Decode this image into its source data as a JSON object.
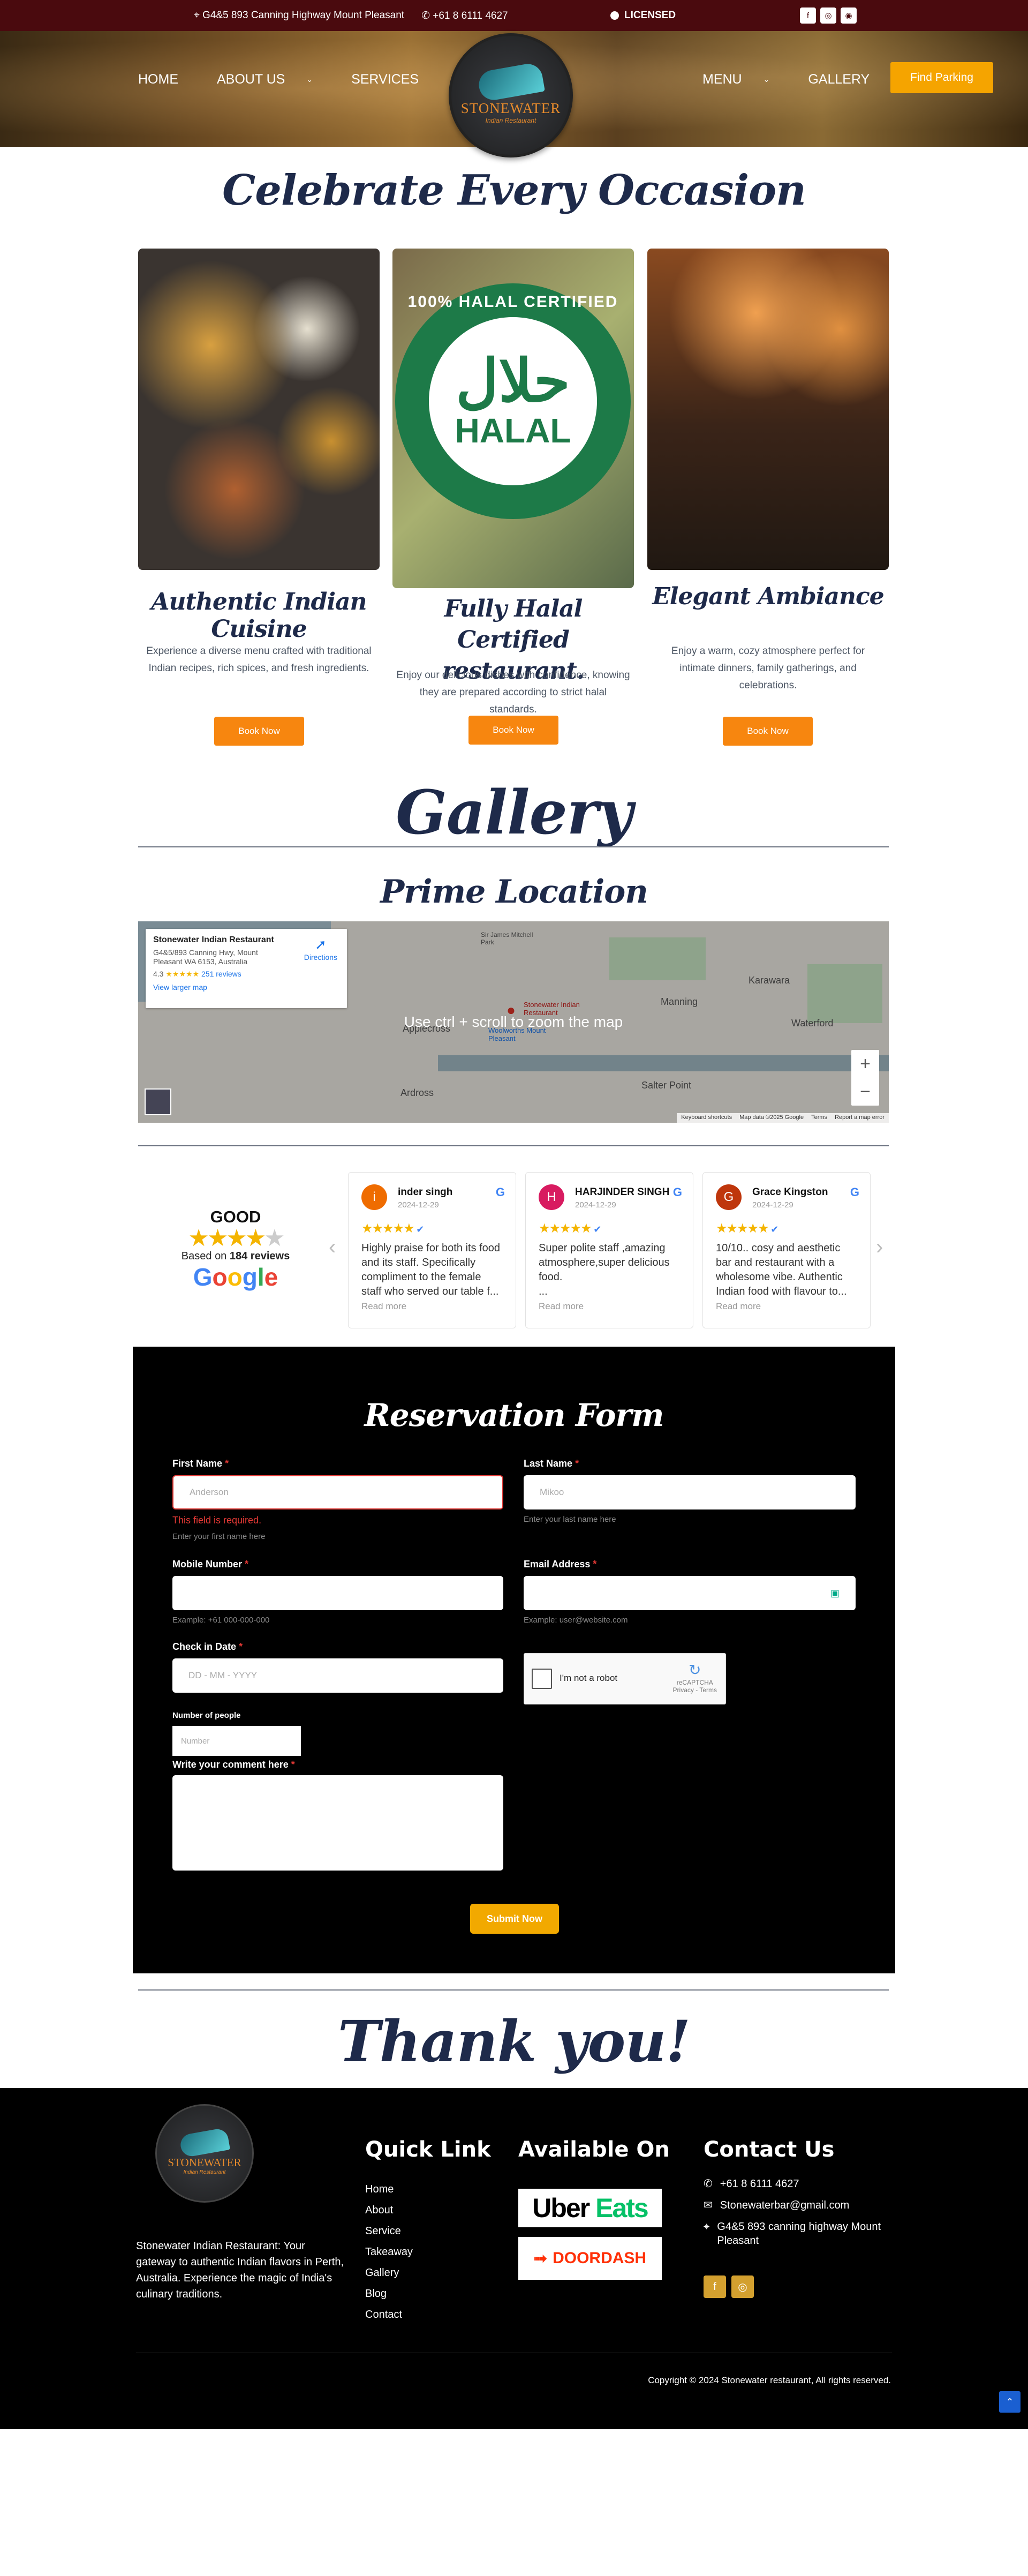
{
  "topbar": {
    "address": "G4&5 893 Canning Highway Mount Pleasant",
    "phone": "+61 8 6111 4627",
    "licensed": "LICENSED"
  },
  "nav": {
    "home": "HOME",
    "about": "ABOUT US",
    "services": "SERVICES",
    "menu": "MENU",
    "gallery": "GALLERY",
    "find_parking": "Find Parking"
  },
  "logo": {
    "name": "STONEWATER",
    "sub": "Indian Restaurant"
  },
  "celebrate": {
    "title": "Celebrate Every Occasion",
    "cards": [
      {
        "title": "Authentic Indian Cuisine",
        "desc": "Experience a diverse menu crafted with traditional Indian recipes, rich spices, and fresh ingredients.",
        "button": "Book Now"
      },
      {
        "title": "Fully Halal Certified restaurant.",
        "desc": "Enjoy our delicious dishes with confidence, knowing they are prepared according to strict halal standards.",
        "button": "Book Now"
      },
      {
        "title": "Elegant Ambiance",
        "desc": "Enjoy a warm, cozy atmosphere perfect for intimate dinners, family gatherings, and celebrations.",
        "button": "Book Now"
      }
    ],
    "halal": {
      "arabic": "حلال",
      "english": "HALAL",
      "ring": "100% HALAL CERTIFIED"
    }
  },
  "gallery_title": "Gallery",
  "location": {
    "title": "Prime Location",
    "info_name": "Stonewater Indian Restaurant",
    "info_address": "G4&5/893 Canning Hwy, Mount Pleasant WA 6153, Australia",
    "rating": "4.3",
    "reviews_link": "251 reviews",
    "directions": "Directions",
    "larger_map": "View larger map",
    "overlay": "Use ctrl + scroll to zoom the map",
    "places": [
      "Applecross",
      "Manning",
      "Karawara",
      "Waterford",
      "Salter Point",
      "Ardross",
      "Stonewater Indian Restaurant",
      "Woolworths Mount Pleasant",
      "Sir James Mitchell Park"
    ],
    "footer": [
      "Keyboard shortcuts",
      "Map data ©2025 Google",
      "Terms",
      "Report a map error"
    ]
  },
  "reviews": {
    "summary": {
      "label": "GOOD",
      "based": "Based on",
      "count": "184 reviews",
      "brand": "Google"
    },
    "items": [
      {
        "initial": "i",
        "name": "inder singh",
        "date": "2024-12-29",
        "text": "Highly praise for both its food and its staff. Specifically compliment to the female staff who served our table f...",
        "more": "Read more",
        "color": "#ef6c00"
      },
      {
        "initial": "H",
        "name": "HARJINDER SINGH",
        "date": "2024-12-29",
        "text": "Super polite staff ,amazing atmosphere,super delicious food.\n...",
        "more": "Read more",
        "color": "#d81b60"
      },
      {
        "initial": "G",
        "name": "Grace Kingston",
        "date": "2024-12-29",
        "text": "10/10.. cosy and aesthetic bar and restaurant with a wholesome vibe. Authentic Indian food with flavour to...",
        "more": "Read more",
        "color": "#bf360c"
      }
    ]
  },
  "form": {
    "title": "Reservation Form",
    "first_name": {
      "label": "First Name",
      "value": "Anderson",
      "error": "This field is required.",
      "hint": "Enter your first name here"
    },
    "last_name": {
      "label": "Last Name",
      "placeholder": "Mikoo",
      "hint": "Enter your last name here"
    },
    "mobile": {
      "label": "Mobile Number",
      "hint": "Example: +61 000-000-000"
    },
    "email": {
      "label": "Email Address",
      "hint": "Example: user@website.com"
    },
    "checkin": {
      "label": "Check in Date",
      "placeholder": "DD - MM - YYYY"
    },
    "captcha": {
      "label": "I'm not a robot",
      "brand": "reCAPTCHA",
      "links": "Privacy - Terms"
    },
    "people": {
      "label": "Number of people",
      "placeholder": "Number"
    },
    "comment": {
      "label": "Write your comment here"
    },
    "submit": "Submit Now"
  },
  "thanks": "Thank you!",
  "footer": {
    "description": "Stonewater Indian Restaurant: Your gateway to authentic Indian flavors in Perth, Australia. Experience the magic of India's culinary traditions.",
    "quick_title": "Quick Link",
    "links": [
      "Home",
      "About",
      "Service",
      "Takeaway",
      "Gallery",
      "Blog",
      "Contact"
    ],
    "available_title": "Available On",
    "ubereats": {
      "a": "Uber",
      "b": "Eats"
    },
    "doordash": "DOORDASH",
    "contact_title": "Contact Us",
    "phone": "+61 8 6111 4627",
    "email": "Stonewaterbar@gmail.com",
    "address": "G4&5 893 canning highway Mount Pleasant",
    "copyright": "Copyright © 2024 Stonewater restaurant, All rights reserved."
  }
}
